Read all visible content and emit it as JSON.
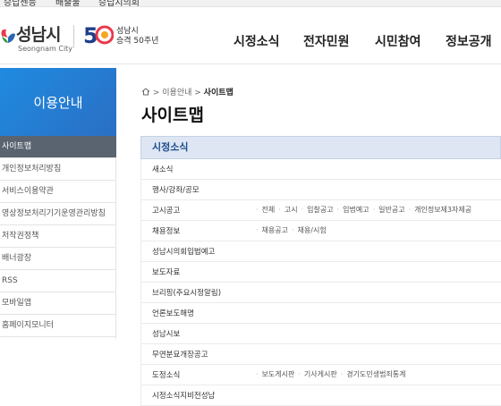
{
  "topstrip": [
    "승답센등",
    "배출물",
    "승답지의회"
  ],
  "logo": {
    "name": "성남시",
    "eng": "Seongnam City",
    "anniv_line1": "성남시",
    "anniv_line2": "승격 50주년"
  },
  "gnav": [
    "시정소식",
    "전자민원",
    "시민참여",
    "정보공개"
  ],
  "lnb": {
    "title": "이용안내",
    "items": [
      "사이트맵",
      "개인정보처리방침",
      "서비스이용약관",
      "영상정보처리기기운영관리방침",
      "저작권정책",
      "배너광장",
      "RSS",
      "모바일앱",
      "홈페이지모니터"
    ],
    "active_index": 0
  },
  "breadcrumb": {
    "first": "이용안내",
    "current": "사이트맵"
  },
  "page_title": "사이트맵",
  "section_title": "시정소식",
  "rows": [
    {
      "label": "새소식",
      "links": []
    },
    {
      "label": "행사/강좌/공모",
      "links": []
    },
    {
      "label": "고시공고",
      "links": [
        "전체",
        "고시",
        "입찰공고",
        "입법예고",
        "일반공고",
        "개인정보제3자제공"
      ]
    },
    {
      "label": "채용정보",
      "links": [
        "채용공고",
        "채용/시험"
      ]
    },
    {
      "label": "성남시의회입법예고",
      "links": []
    },
    {
      "label": "보도자료",
      "links": []
    },
    {
      "label": "브리핑(주요시정알림)",
      "links": []
    },
    {
      "label": "언론보도해명",
      "links": []
    },
    {
      "label": "성남시보",
      "links": []
    },
    {
      "label": "무연분묘개장공고",
      "links": []
    },
    {
      "label": "도정소식",
      "links": [
        "보도게시판",
        "기사게시판",
        "경기도민생범죄통계"
      ]
    },
    {
      "label": "시정소식지비전성남",
      "links": []
    }
  ],
  "colors": {
    "lnb_blue": "#2a7dd6",
    "lnb_active": "#5a6370",
    "section_bg": "#dde6f2"
  }
}
